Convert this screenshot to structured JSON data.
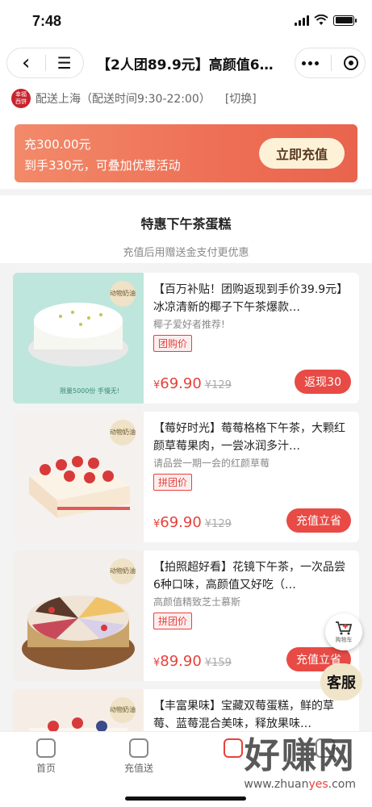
{
  "status": {
    "time": "7:48"
  },
  "nav": {
    "back_icon": "‹",
    "menu_icon": "☰",
    "title": "【2人团89.9元】高颜值6…"
  },
  "delivery": {
    "logo_text": "幸福西饼",
    "text": "配送上海（配送时间9:30-22:00）",
    "switch_label": "[切换]"
  },
  "recharge": {
    "line1": "充300.00元",
    "line2": "到手330元，可叠加优惠活动",
    "button": "立即充值"
  },
  "section": {
    "title": "特惠下午茶蛋糕",
    "subtitle": "充值后用赠送金支付更优惠"
  },
  "products": [
    {
      "title": "【百万补贴！团购返现到手价39.9元】冰凉清新的椰子下午茶爆款…",
      "subtitle": "椰子爱好者推荐!",
      "tag": "团购价",
      "currency": "¥",
      "price": "69.90",
      "original": "¥129",
      "action": "返现30",
      "badge": "动物奶油",
      "thumb_caption": "限量5000份 手慢无!"
    },
    {
      "title": "【莓好时光】莓莓格格下午茶，大颗红颜草莓果肉，一尝冰润多汁…",
      "subtitle": "请品尝一期一会的红颜草莓",
      "tag": "拼团价",
      "currency": "¥",
      "price": "69.90",
      "original": "¥129",
      "action": "充值立省",
      "badge": "动物奶油"
    },
    {
      "title": "【拍照超好看】花镜下午茶，一次品尝6种口味，高颜值又好吃（…",
      "subtitle": "高颜值精致芝士慕斯",
      "tag": "拼团价",
      "currency": "¥",
      "price": "89.90",
      "original": "¥159",
      "action": "充值立省",
      "badge": "动物奶油"
    },
    {
      "title": "【丰富果味】宝藏双莓蛋糕，鲜的草莓、蓝莓混合美味，释放果味…",
      "subtitle": "",
      "tag": "",
      "currency": "",
      "price": "",
      "original": "",
      "action": "",
      "badge": "动物奶油"
    }
  ],
  "floats": {
    "cart_label": "购物车",
    "service": "客服"
  },
  "tabs": [
    {
      "label": "首页"
    },
    {
      "label": "充值送"
    }
  ],
  "watermark": {
    "big": "好赚网",
    "url_a": "www.zhuan",
    "url_b": "yes",
    "url_c": ".com"
  }
}
